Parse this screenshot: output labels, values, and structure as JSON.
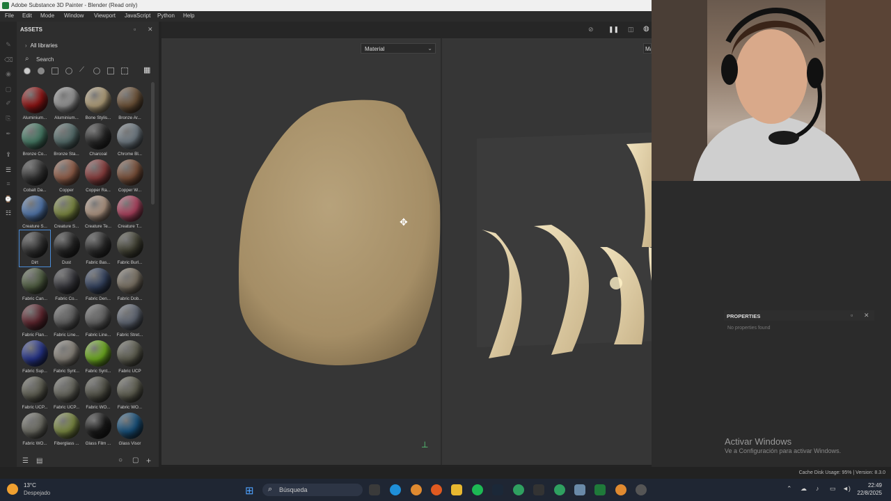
{
  "window": {
    "title": "Adobe Substance 3D Painter - Blender (Read only)"
  },
  "menu": [
    "File",
    "Edit",
    "Mode",
    "Window",
    "Viewport",
    "JavaScript",
    "Python",
    "Help"
  ],
  "assets": {
    "title": "ASSETS",
    "libraries_label": "All libraries",
    "search_label": "Search",
    "items": [
      {
        "label": "Aluminium...",
        "color": "#a11616"
      },
      {
        "label": "Aluminium...",
        "color": "#a8a8a8"
      },
      {
        "label": "Bone Stylis...",
        "color": "#c9b48a"
      },
      {
        "label": "Bronze Ar...",
        "color": "#7a5c3e"
      },
      {
        "label": "Bronze Co...",
        "color": "#4f8a72"
      },
      {
        "label": "Bronze Sta...",
        "color": "#5f7a78"
      },
      {
        "label": "Charcoal",
        "color": "#2c2c2c"
      },
      {
        "label": "Chrome Bl...",
        "color": "#7d8a94"
      },
      {
        "label": "Cobalt Da...",
        "color": "#3a3a3a"
      },
      {
        "label": "Copper",
        "color": "#a46a52"
      },
      {
        "label": "Copper Ra...",
        "color": "#9a4444"
      },
      {
        "label": "Copper W...",
        "color": "#8a5a40"
      },
      {
        "label": "Creature S...",
        "color": "#5c86c2"
      },
      {
        "label": "Creature S...",
        "color": "#8c9a4a"
      },
      {
        "label": "Creature Te...",
        "color": "#c7aa94"
      },
      {
        "label": "Creature T...",
        "color": "#c24a6a"
      },
      {
        "label": "Dirt",
        "color": "#3a3a3a"
      },
      {
        "label": "Dust",
        "color": "#2a2a2a"
      },
      {
        "label": "Fabric Bas...",
        "color": "#303030"
      },
      {
        "label": "Fabric Burl...",
        "color": "#4a4a3a"
      },
      {
        "label": "Fabric Can...",
        "color": "#5a6a4a"
      },
      {
        "label": "Fabric Co...",
        "color": "#3e3e44"
      },
      {
        "label": "Fabric Den...",
        "color": "#3a4a6a"
      },
      {
        "label": "Fabric Dob...",
        "color": "#8a8070"
      },
      {
        "label": "Fabric Flan...",
        "color": "#6a2a34"
      },
      {
        "label": "Fabric Line...",
        "color": "#6a6a6a"
      },
      {
        "label": "Fabric Line...",
        "color": "#6e6e6e"
      },
      {
        "label": "Fabric Stret...",
        "color": "#6a7280"
      },
      {
        "label": "Fabric Sup...",
        "color": "#2a3a9a"
      },
      {
        "label": "Fabric Synt...",
        "color": "#9a948a"
      },
      {
        "label": "Fabric Synt...",
        "color": "#7cc224"
      },
      {
        "label": "Fabric UCP",
        "color": "#6a6a5a"
      },
      {
        "label": "Fabric UCP...",
        "color": "#6a6a5c"
      },
      {
        "label": "Fabric UCP...",
        "color": "#727268"
      },
      {
        "label": "Fabric WO...",
        "color": "#5c5c50"
      },
      {
        "label": "Fabric WO...",
        "color": "#6a6a5a"
      },
      {
        "label": "Fabric WO...",
        "color": "#7a7a70"
      },
      {
        "label": "Fiberglass ...",
        "color": "#8a9a4a"
      },
      {
        "label": "Glass Film ...",
        "color": "#1c1c1c"
      },
      {
        "label": "Glass Visor",
        "color": "#1a5a8a"
      }
    ],
    "selected_index": 16
  },
  "viewport": {
    "left_dropdown": "Material",
    "right_dropdown": "Ma"
  },
  "properties": {
    "title": "PROPERTIES",
    "empty_text": "No properties found"
  },
  "status": {
    "text": "Cache Disk Usage:   95% | Version: 8.3.0"
  },
  "watermark": {
    "line1": "Activar Windows",
    "line2": "Ve a Configuración para activar Windows."
  },
  "taskbar": {
    "weather_temp": "13°C",
    "weather_desc": "Despejado",
    "search_placeholder": "Búsqueda",
    "time": "22:49",
    "date": "22/8/2025"
  }
}
